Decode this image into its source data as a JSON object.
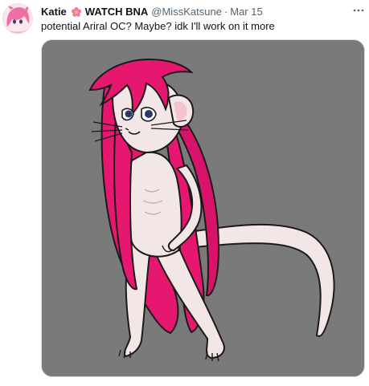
{
  "tweet": {
    "author": {
      "display_name": "Katie",
      "badge_text": "WATCH BNA",
      "handle": "@MissKatsune",
      "avatar_icon": "avatar-icon",
      "emoji_icon": "flower-icon"
    },
    "separator": "·",
    "timestamp": "Mar 15",
    "text": "potential Ariral OC? Maybe? idk I'll work on it more",
    "more_icon": "more-horizontal-icon",
    "media": {
      "type": "image",
      "background_color": "#7a7a7a"
    }
  },
  "colors": {
    "text_primary": "#0f1419",
    "text_secondary": "#536471",
    "hair_pink": "#e5176f",
    "skin": "#f3e6e6",
    "media_bg": "#7a7a7a"
  }
}
